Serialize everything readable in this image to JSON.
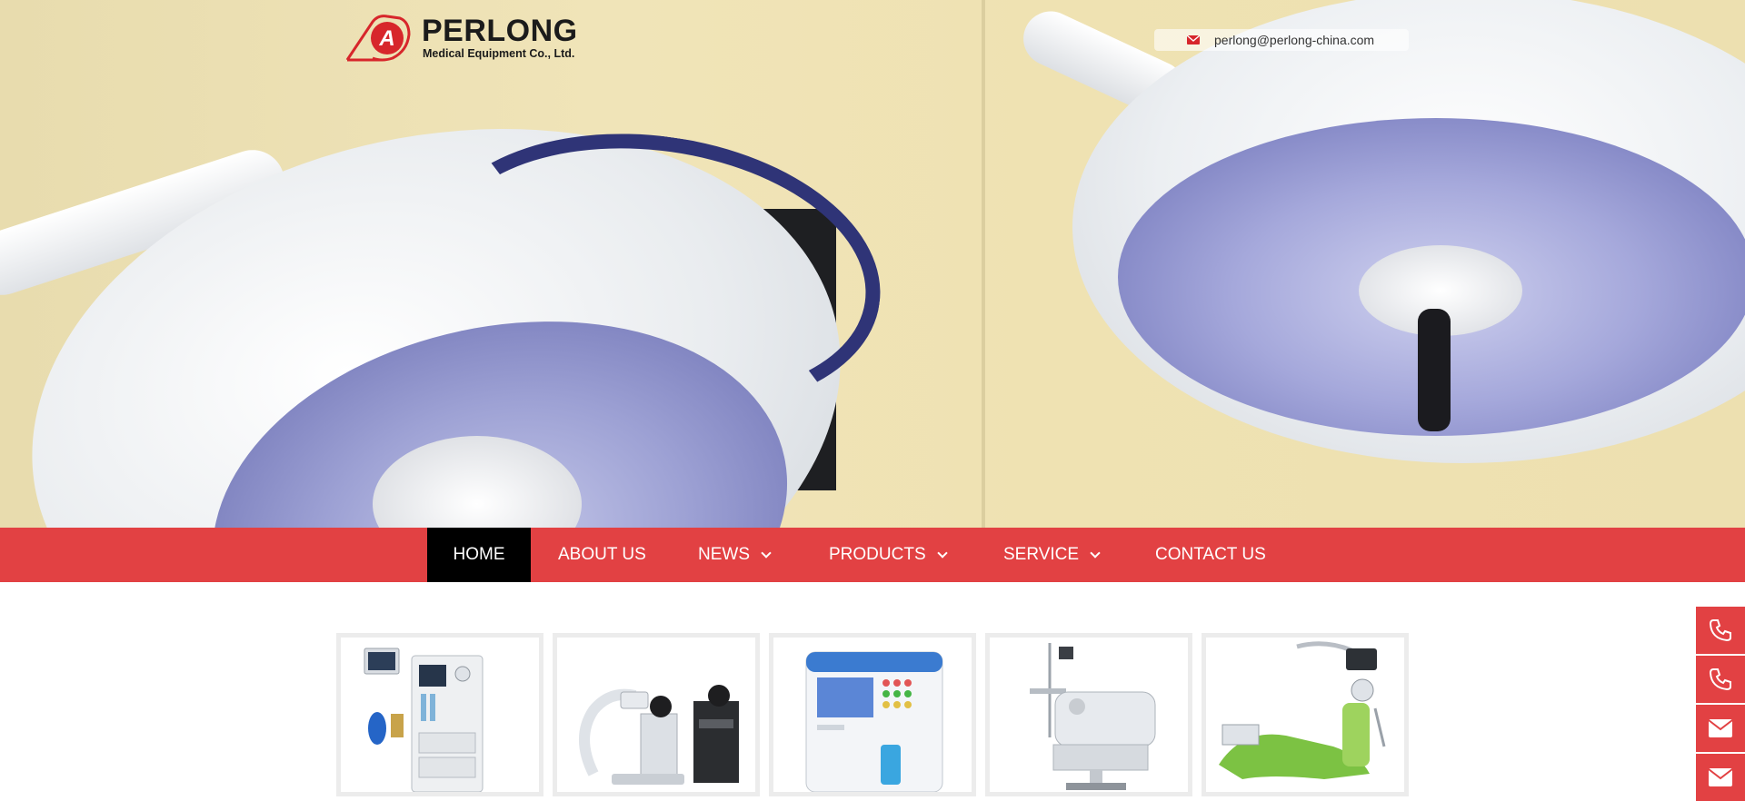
{
  "header": {
    "brand_name": "PERLONG",
    "brand_subtitle": "Medical Equipment Co., Ltd.",
    "logo_letter": "A",
    "email": "perlong@perlong-china.com",
    "email_icon": "envelope-icon"
  },
  "nav": {
    "items": [
      {
        "label": "HOME",
        "active": true,
        "dropdown": false
      },
      {
        "label": "ABOUT US",
        "active": false,
        "dropdown": false
      },
      {
        "label": "NEWS",
        "active": false,
        "dropdown": true
      },
      {
        "label": "PRODUCTS",
        "active": false,
        "dropdown": true
      },
      {
        "label": "SERVICE",
        "active": false,
        "dropdown": true
      },
      {
        "label": "CONTACT US",
        "active": false,
        "dropdown": false
      }
    ]
  },
  "products": {
    "items": [
      {
        "icon": "anesthesia-machine-icon"
      },
      {
        "icon": "c-arm-xray-icon"
      },
      {
        "icon": "hematology-analyzer-icon"
      },
      {
        "icon": "infant-incubator-icon"
      },
      {
        "icon": "dental-chair-icon"
      }
    ]
  },
  "side_contact": {
    "buttons": [
      "phone-icon",
      "phone-icon",
      "envelope-icon",
      "envelope-icon"
    ]
  },
  "colors": {
    "nav_red": "#e24143",
    "active_black": "#000000",
    "text_dark": "#1b1b1b"
  }
}
